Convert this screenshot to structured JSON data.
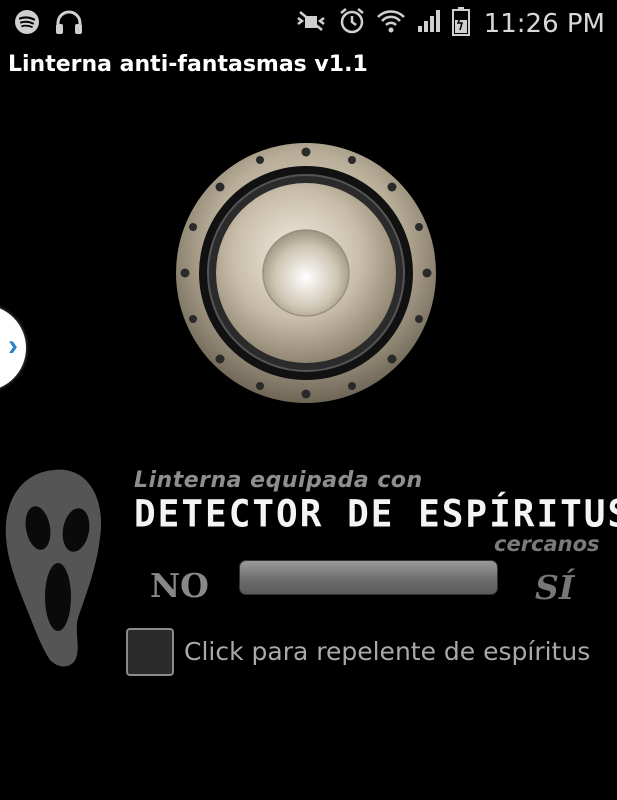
{
  "status_bar": {
    "time": "11:26 PM",
    "left_icons": [
      "spotify-icon",
      "headphones-icon"
    ],
    "right_icons": [
      "mute-icon",
      "alarm-icon",
      "wifi-icon",
      "signal-icon",
      "battery-icon"
    ]
  },
  "app": {
    "title": "Linterna anti-fantasmas v1.1"
  },
  "side_handle": {
    "glyph": "›"
  },
  "promo": {
    "line1": "Linterna equipada con",
    "line2": "DETECTOR DE ESPÍRITUS",
    "line3": "cercanos"
  },
  "detector": {
    "label_no": "NO",
    "label_si": "SÍ",
    "level": 0
  },
  "repellent": {
    "checked": false,
    "label": "Click para repelente de espíritus"
  }
}
